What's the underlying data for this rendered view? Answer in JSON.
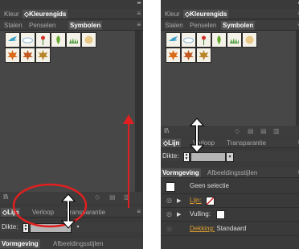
{
  "left": {
    "top_tabs": [
      "Kleur",
      "◇Kleurengids"
    ],
    "mid_tabs": [
      "Stalen",
      "Penselen",
      "Symbolen"
    ],
    "lijn_tabs": [
      "◇Lijn",
      "Verloop",
      "Transparantie"
    ],
    "dikte_label": "Dikte:",
    "bottom_tabs": [
      "Vormgeving",
      "Afbeeldingsstijlen"
    ]
  },
  "right": {
    "top_tabs": [
      "Kleur",
      "◇Kleurengids"
    ],
    "mid_tabs": [
      "Stalen",
      "Penselen",
      "Symbolen"
    ],
    "lijn_tabs": [
      "◇Lijn",
      "Verloop",
      "Transparantie"
    ],
    "dikte_label": "Dikte:",
    "bottom_tabs": [
      "Vormgeving",
      "Afbeeldingsstijlen"
    ],
    "geen_selectie": "Geen selectie",
    "lijn_link": "Lijn:",
    "vulling_label": "Vulling:",
    "dekking_link": "Dekking:",
    "dekking_value": "Standaard"
  },
  "icons": {
    "panel_menu": "≡",
    "collapse": "▸▸",
    "eye": "◎",
    "triangle": "▶",
    "library": "Il\\",
    "dropdown": "▾"
  },
  "colors": {
    "panel_bg": "#3a3a3a",
    "active_tab": "#505050",
    "annotation_red": "#e02020",
    "link_orange": "#e0a030"
  }
}
